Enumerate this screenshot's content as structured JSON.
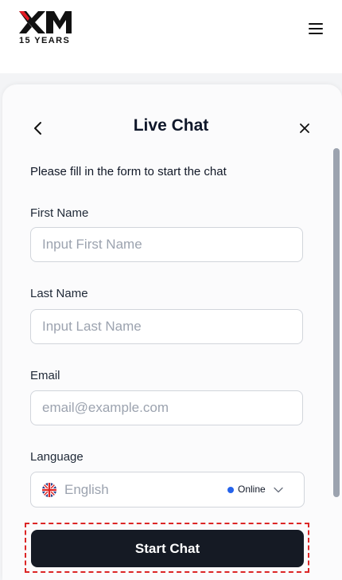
{
  "header": {
    "logo_text": "XM",
    "logo_tagline": "15 YEARS",
    "menu_icon": "hamburger-icon"
  },
  "chat": {
    "title": "Live Chat",
    "back_icon": "chevron-left-icon",
    "close_icon": "close-icon",
    "intro": "Please fill in the form to start the chat",
    "first_name": {
      "label": "First Name",
      "placeholder": "Input First Name",
      "value": ""
    },
    "last_name": {
      "label": "Last Name",
      "placeholder": "Input Last Name",
      "value": ""
    },
    "email": {
      "label": "Email",
      "placeholder": "email@example.com",
      "value": ""
    },
    "language": {
      "label": "Language",
      "selected": "English",
      "flag_icon": "uk-flag-icon",
      "status": "Online",
      "status_color": "#2563eb",
      "dropdown_icon": "chevron-down-icon"
    },
    "submit_label": "Start Chat"
  },
  "colors": {
    "accent_dark": "#151a24",
    "brand_red": "#e31b23",
    "highlight": "#dc2626"
  }
}
